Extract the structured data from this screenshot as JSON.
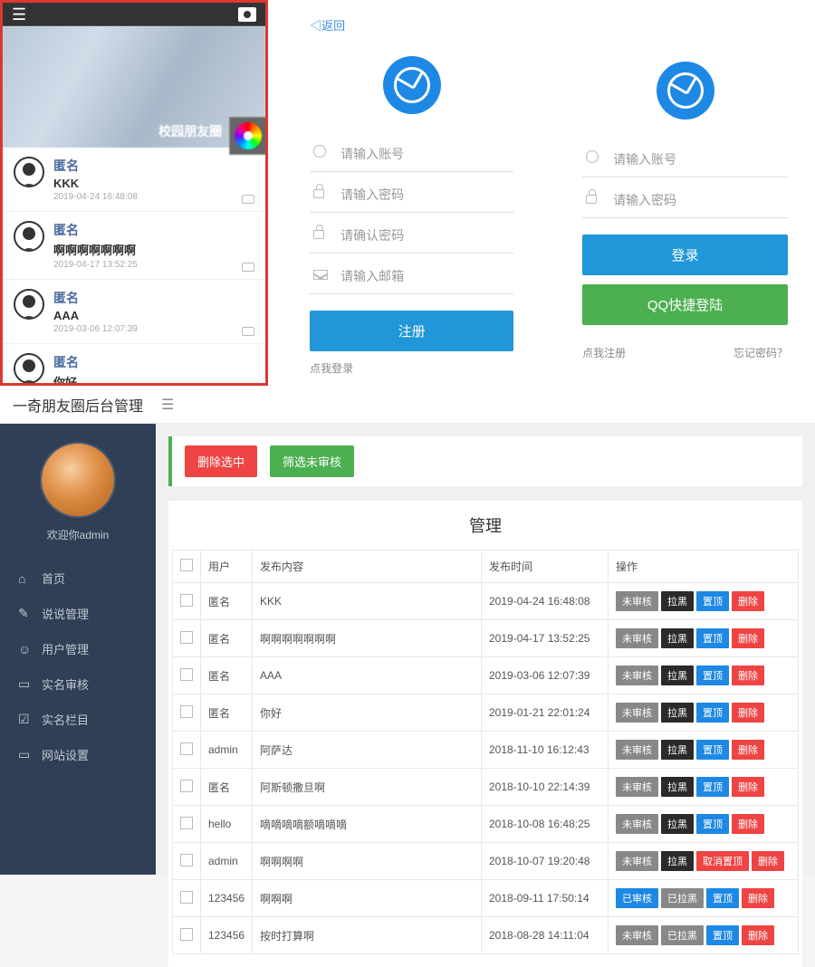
{
  "mobile": {
    "cover_label": "校园朋友圈",
    "feed": [
      {
        "user": "匿名",
        "text": "KKK",
        "time": "2019-04-24 16:48:08"
      },
      {
        "user": "匿名",
        "text": "啊啊啊啊啊啊啊",
        "time": "2019-04-17 13:52:25"
      },
      {
        "user": "匿名",
        "text": "AAA",
        "time": "2019-03-06 12:07:39"
      },
      {
        "user": "匿名",
        "text": "你好",
        "time": ""
      }
    ]
  },
  "register": {
    "back": "◁返回",
    "account_ph": "请输入账号",
    "password_ph": "请输入密码",
    "confirm_ph": "请确认密码",
    "email_ph": "请输入邮箱",
    "submit": "注册",
    "login_link": "点我登录"
  },
  "login": {
    "account_ph": "请输入账号",
    "password_ph": "请输入密码",
    "submit": "登录",
    "qq_login": "QQ快捷登陆",
    "register_link": "点我注册",
    "forgot_link": "忘记密码？"
  },
  "admin": {
    "title": "一奇朋友圈后台管理",
    "welcome": "欢迎你admin",
    "sidebar": [
      {
        "icon": "⌂",
        "label": "首页"
      },
      {
        "icon": "✎",
        "label": "说说管理"
      },
      {
        "icon": "☺",
        "label": "用户管理"
      },
      {
        "icon": "▭",
        "label": "实名审核"
      },
      {
        "icon": "☑",
        "label": "实名栏目"
      },
      {
        "icon": "▭",
        "label": "网站设置"
      }
    ],
    "actions": {
      "delete_selected": "删除选中",
      "filter_pending": "筛选未审核"
    },
    "table": {
      "title": "管理",
      "headers": {
        "user": "用户",
        "content": "发布内容",
        "time": "发布时间",
        "ops": "操作"
      }
    },
    "btn_labels": {
      "pending": "未审核",
      "approved": "已审核",
      "blacklist": "拉黑",
      "blacklisted": "已拉黑",
      "pin": "置顶",
      "unpin": "取消置顶",
      "delete": "删除"
    },
    "rows": [
      {
        "user": "匿名",
        "content": "KKK",
        "time": "2019-04-24 16:48:08",
        "review": "pending",
        "black": "blacklist",
        "pin": "pin"
      },
      {
        "user": "匿名",
        "content": "啊啊啊啊啊啊啊",
        "time": "2019-04-17 13:52:25",
        "review": "pending",
        "black": "blacklist",
        "pin": "pin"
      },
      {
        "user": "匿名",
        "content": "AAA",
        "time": "2019-03-06 12:07:39",
        "review": "pending",
        "black": "blacklist",
        "pin": "pin"
      },
      {
        "user": "匿名",
        "content": "你好",
        "time": "2019-01-21 22:01:24",
        "review": "pending",
        "black": "blacklist",
        "pin": "pin"
      },
      {
        "user": "admin",
        "content": "阿萨达",
        "time": "2018-11-10 16:12:43",
        "review": "pending",
        "black": "blacklist",
        "pin": "pin"
      },
      {
        "user": "匿名",
        "content": "阿斯顿撒旦啊",
        "time": "2018-10-10 22:14:39",
        "review": "pending",
        "black": "blacklist",
        "pin": "pin"
      },
      {
        "user": "hello",
        "content": "嘀嘀嘀嘀额嘀嘀嘀",
        "time": "2018-10-08 16:48:25",
        "review": "pending",
        "black": "blacklist",
        "pin": "pin"
      },
      {
        "user": "admin",
        "content": "啊啊啊啊",
        "time": "2018-10-07 19:20:48",
        "review": "pending",
        "black": "blacklist",
        "pin": "unpin"
      },
      {
        "user": "123456",
        "content": "啊啊啊",
        "time": "2018-09-11 17:50:14",
        "review": "approved",
        "black": "blacklisted",
        "pin": "pin"
      },
      {
        "user": "123456",
        "content": "按时打算啊",
        "time": "2018-08-28 14:11:04",
        "review": "pending",
        "black": "blacklisted",
        "pin": "pin"
      }
    ]
  }
}
